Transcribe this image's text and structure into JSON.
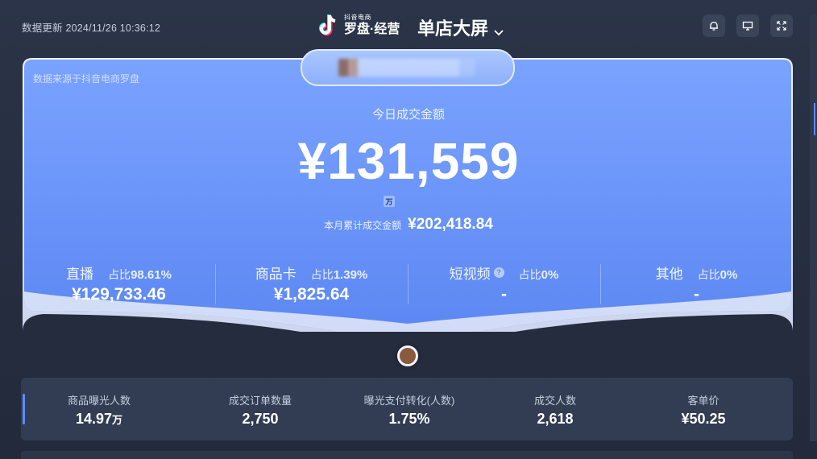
{
  "header": {
    "update_time": "数据更新 2024/11/26 10:36:12",
    "brand_small": "抖音电商",
    "brand_big": "罗盘·经营",
    "screen_title": "单店大屏"
  },
  "hero": {
    "source_note": "数据来源于抖音电商罗盘",
    "today_label": "今日成交金额",
    "today_amount": "¥131,559",
    "unit_badge": "万",
    "month_label": "本月累计成交金额",
    "month_value": "¥202,418.84"
  },
  "channels": [
    {
      "name": "直播",
      "share_label": "占比",
      "share": "98.61%",
      "value": "¥129,733.46"
    },
    {
      "name": "商品卡",
      "share_label": "占比",
      "share": "1.39%",
      "value": "¥1,825.64"
    },
    {
      "name": "短视频",
      "share_label": "占比",
      "share": "0%",
      "value": "-"
    },
    {
      "name": "其他",
      "share_label": "占比",
      "share": "0%",
      "value": "-"
    }
  ],
  "metrics": [
    {
      "label": "商品曝光人数",
      "value": "14.97",
      "unit": "万"
    },
    {
      "label": "成交订单数量",
      "value": "2,750",
      "unit": ""
    },
    {
      "label": "曝光支付转化(人数)",
      "value": "1.75%",
      "unit": ""
    },
    {
      "label": "成交人数",
      "value": "2,618",
      "unit": ""
    },
    {
      "label": "客单价",
      "value": "¥50.25",
      "unit": ""
    }
  ],
  "colors": {
    "hero_top": "#7aa3ff",
    "hero_bottom": "#5b86f2",
    "accent": "#5b8cff",
    "background": "#262e40"
  },
  "icons": [
    "bell-icon",
    "monitor-icon",
    "fullscreen-icon",
    "chevron-down-icon",
    "help-icon",
    "tiktok-logo-icon"
  ]
}
